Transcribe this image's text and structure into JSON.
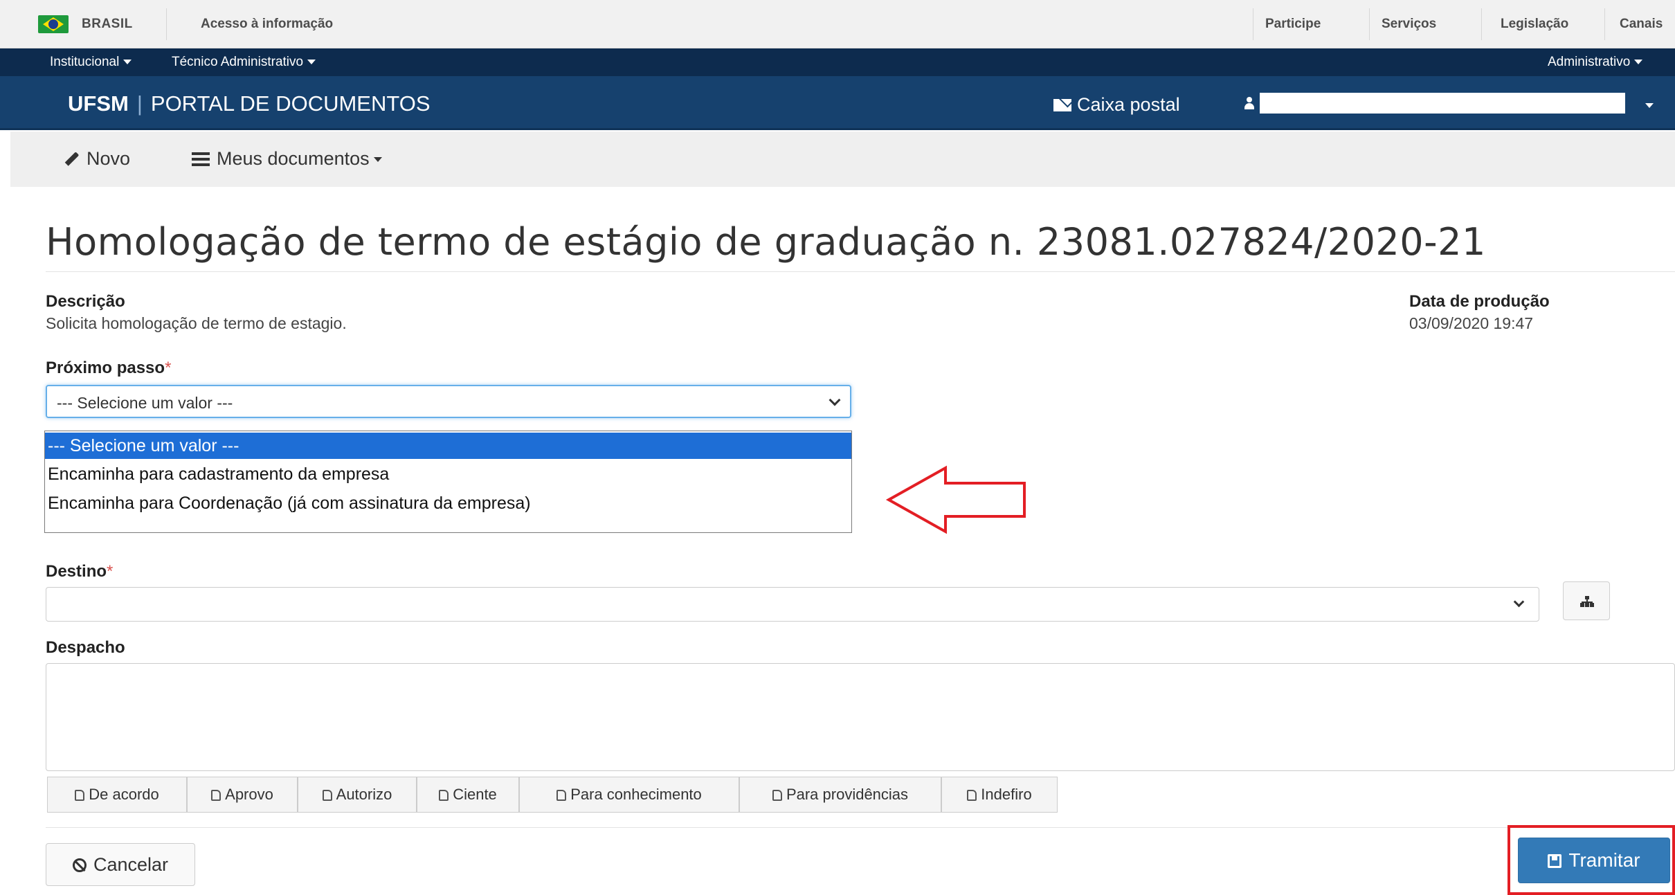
{
  "gov_bar": {
    "brasil": "BRASIL",
    "acesso": "Acesso à informação",
    "links": [
      "Participe",
      "Serviços",
      "Legislação",
      "Canais"
    ]
  },
  "top_menu": {
    "institucional": "Institucional",
    "tecnico": "Técnico Administrativo",
    "administrativo": "Administrativo"
  },
  "portal": {
    "brand_bold": "UFSM",
    "brand_name": "PORTAL DE DOCUMENTOS",
    "caixa_postal": "Caixa postal"
  },
  "toolbar": {
    "novo": "Novo",
    "meus_documentos": "Meus documentos"
  },
  "page": {
    "title": "Homologação de termo de estágio de graduação n. 23081.027824/2020-21"
  },
  "descricao": {
    "label": "Descrição",
    "value": "Solicita homologação de termo de estagio."
  },
  "data_producao": {
    "label": "Data de produção",
    "value": "03/09/2020 19:47"
  },
  "proximo_passo": {
    "label": "Próximo passo",
    "required_mark": "*",
    "selected": "--- Selecione um valor ---",
    "options": [
      "--- Selecione um valor ---",
      "Encaminha para cadastramento da empresa",
      "Encaminha para Coordenação (já com assinatura da empresa)"
    ]
  },
  "destino": {
    "label": "Destino",
    "required_mark": "*",
    "value": ""
  },
  "despacho": {
    "label": "Despacho",
    "value": "",
    "quick_buttons": [
      "De acordo",
      "Aprovo",
      "Autorizo",
      "Ciente",
      "Para conhecimento",
      "Para providências",
      "Indefiro"
    ]
  },
  "actions": {
    "cancelar": "Cancelar",
    "tramitar": "Tramitar"
  },
  "colors": {
    "navy": "#0d2b4e",
    "portal_blue": "#16416e",
    "primary": "#337ab7",
    "highlight_red": "#e31e24",
    "option_selected": "#1e6ed6"
  }
}
